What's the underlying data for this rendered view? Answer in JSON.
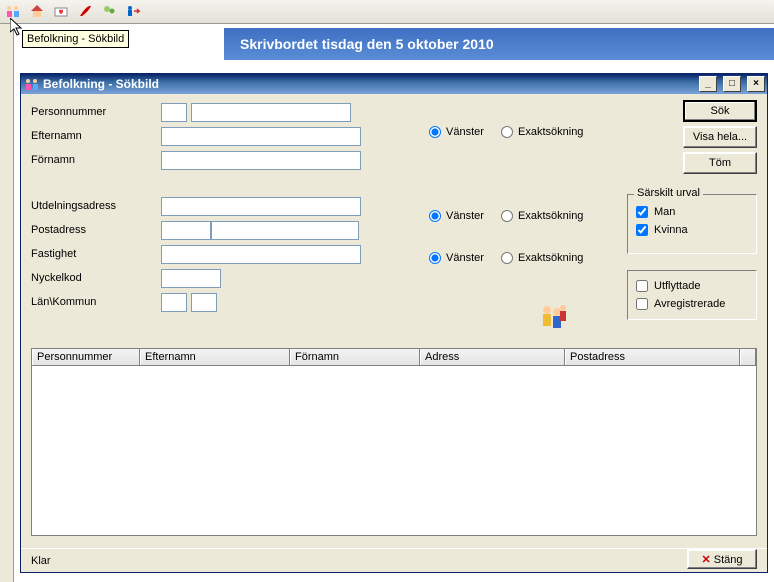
{
  "toolbar": {
    "icons": [
      "people-icon",
      "house-icon",
      "heart-letter-icon",
      "feather-icon",
      "users-icon",
      "person-arrow-icon"
    ],
    "tooltip": "Befolkning - Sökbild"
  },
  "banner": {
    "text": "Skrivbordet tisdag den 5 oktober 2010"
  },
  "window": {
    "title": "Befolkning - Sökbild",
    "minimize": "_",
    "maximize": "□",
    "close": "×"
  },
  "labels": {
    "personnummer": "Personnummer",
    "efternamn": "Efternamn",
    "fornamn": "Förnamn",
    "utdelningsadress": "Utdelningsadress",
    "postadress": "Postadress",
    "fastighet": "Fastighet",
    "nyckelkod": "Nyckelkod",
    "lankommun": "Län\\Kommun"
  },
  "radios": {
    "vanster": "Vänster",
    "exakt": "Exaktsökning"
  },
  "buttons": {
    "sok": "Sök",
    "visahela": "Visa hela...",
    "tom": "Töm",
    "stang": "Stäng"
  },
  "sarskilt": {
    "legend": "Särskilt urval",
    "man": "Man",
    "kvinna": "Kvinna",
    "utflyttade": "Utflyttade",
    "avregistrerade": "Avregistrerade"
  },
  "columns": {
    "personnummer": "Personnummer",
    "efternamn": "Efternamn",
    "fornamn": "Förnamn",
    "adress": "Adress",
    "postadress": "Postadress"
  },
  "status": {
    "text": "Klar"
  }
}
